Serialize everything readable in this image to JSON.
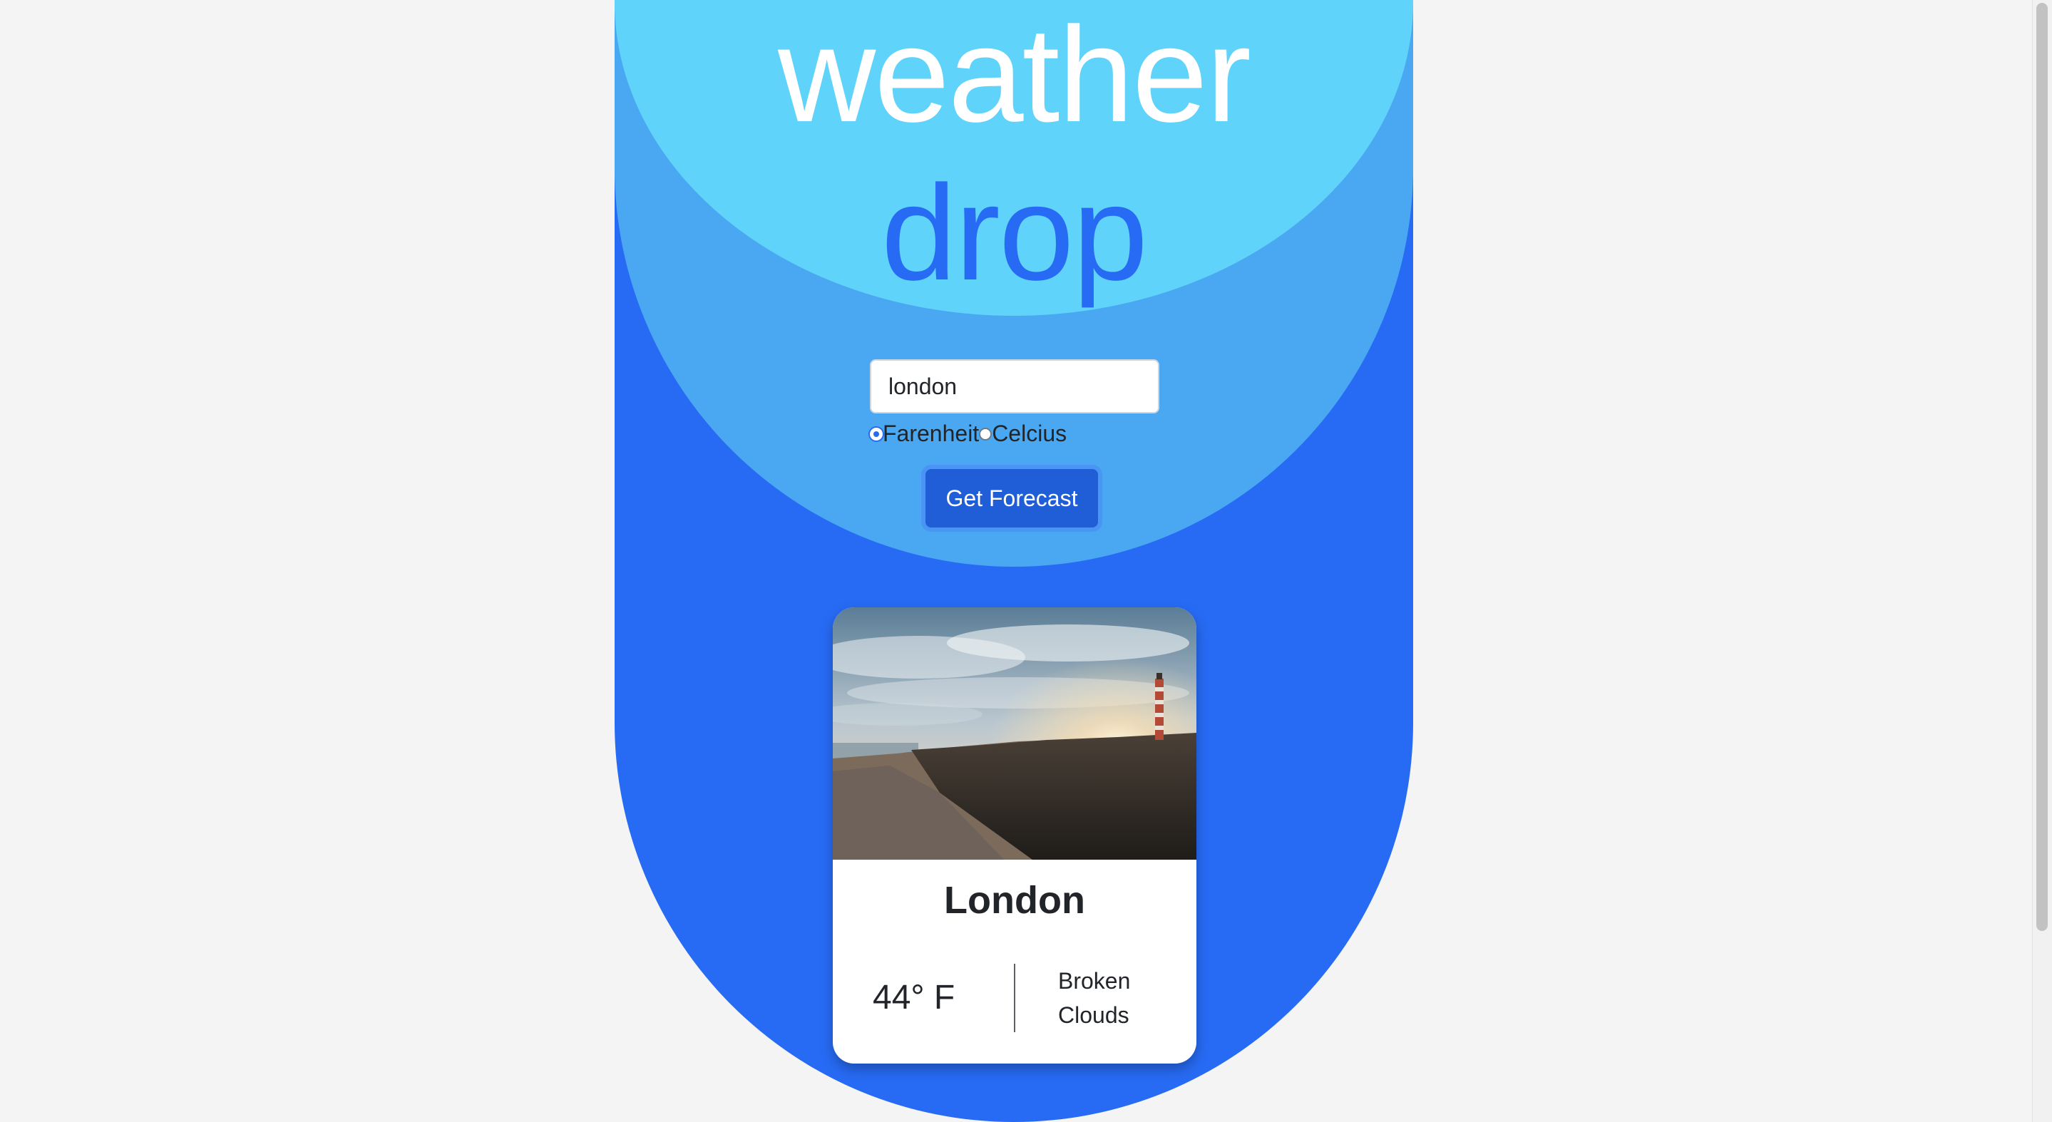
{
  "logo": {
    "line1": "weather",
    "line2": "drop"
  },
  "search": {
    "value": "london",
    "units": [
      {
        "label": "Farenheit",
        "checked": true
      },
      {
        "label": "Celcius",
        "checked": false
      }
    ],
    "submit_label": "Get Forecast"
  },
  "card": {
    "city": "London",
    "temperature": "44° F",
    "description_line1": "Broken",
    "description_line2": "Clouds"
  },
  "colors": {
    "brand_blue": "#276bf5",
    "mid_blue": "#4aa8f3",
    "light_blue": "#5fd3f9",
    "button_blue": "#1f5ed6",
    "background": "#f4f4f4"
  }
}
